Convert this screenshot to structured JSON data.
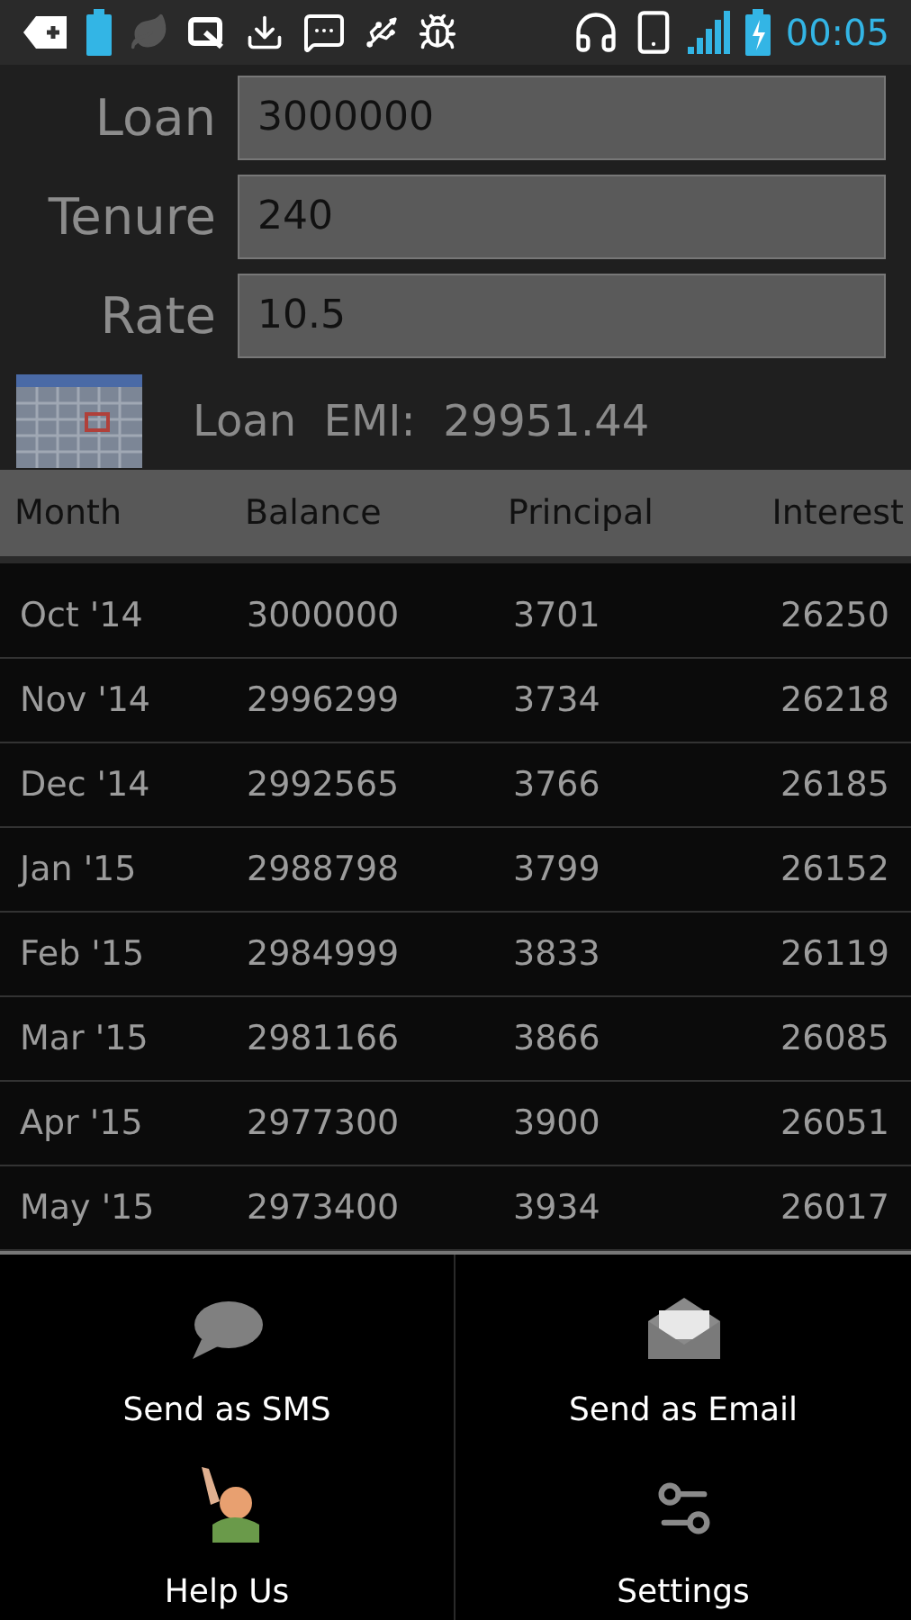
{
  "status_bar": {
    "time": "00:05"
  },
  "form": {
    "fields": [
      {
        "label": "Loan",
        "value": "3000000"
      },
      {
        "label": "Tenure",
        "value": "240"
      },
      {
        "label": "Rate",
        "value": "10.5"
      }
    ],
    "result": "Loan  EMI:  29951.44"
  },
  "table": {
    "columns": [
      "Month",
      "Balance",
      "Principal",
      "Interest"
    ],
    "rows": [
      [
        "Oct '14",
        "3000000",
        "3701",
        "26250"
      ],
      [
        "Nov '14",
        "2996299",
        "3734",
        "26218"
      ],
      [
        "Dec '14",
        "2992565",
        "3766",
        "26185"
      ],
      [
        "Jan '15",
        "2988798",
        "3799",
        "26152"
      ],
      [
        "Feb '15",
        "2984999",
        "3833",
        "26119"
      ],
      [
        "Mar '15",
        "2981166",
        "3866",
        "26085"
      ],
      [
        "Apr '15",
        "2977300",
        "3900",
        "26051"
      ],
      [
        "May '15",
        "2973400",
        "3934",
        "26017"
      ]
    ]
  },
  "menu": {
    "items": [
      {
        "label": "Send as SMS"
      },
      {
        "label": "Send as Email"
      },
      {
        "label": "Help Us"
      },
      {
        "label": "Settings"
      }
    ]
  }
}
